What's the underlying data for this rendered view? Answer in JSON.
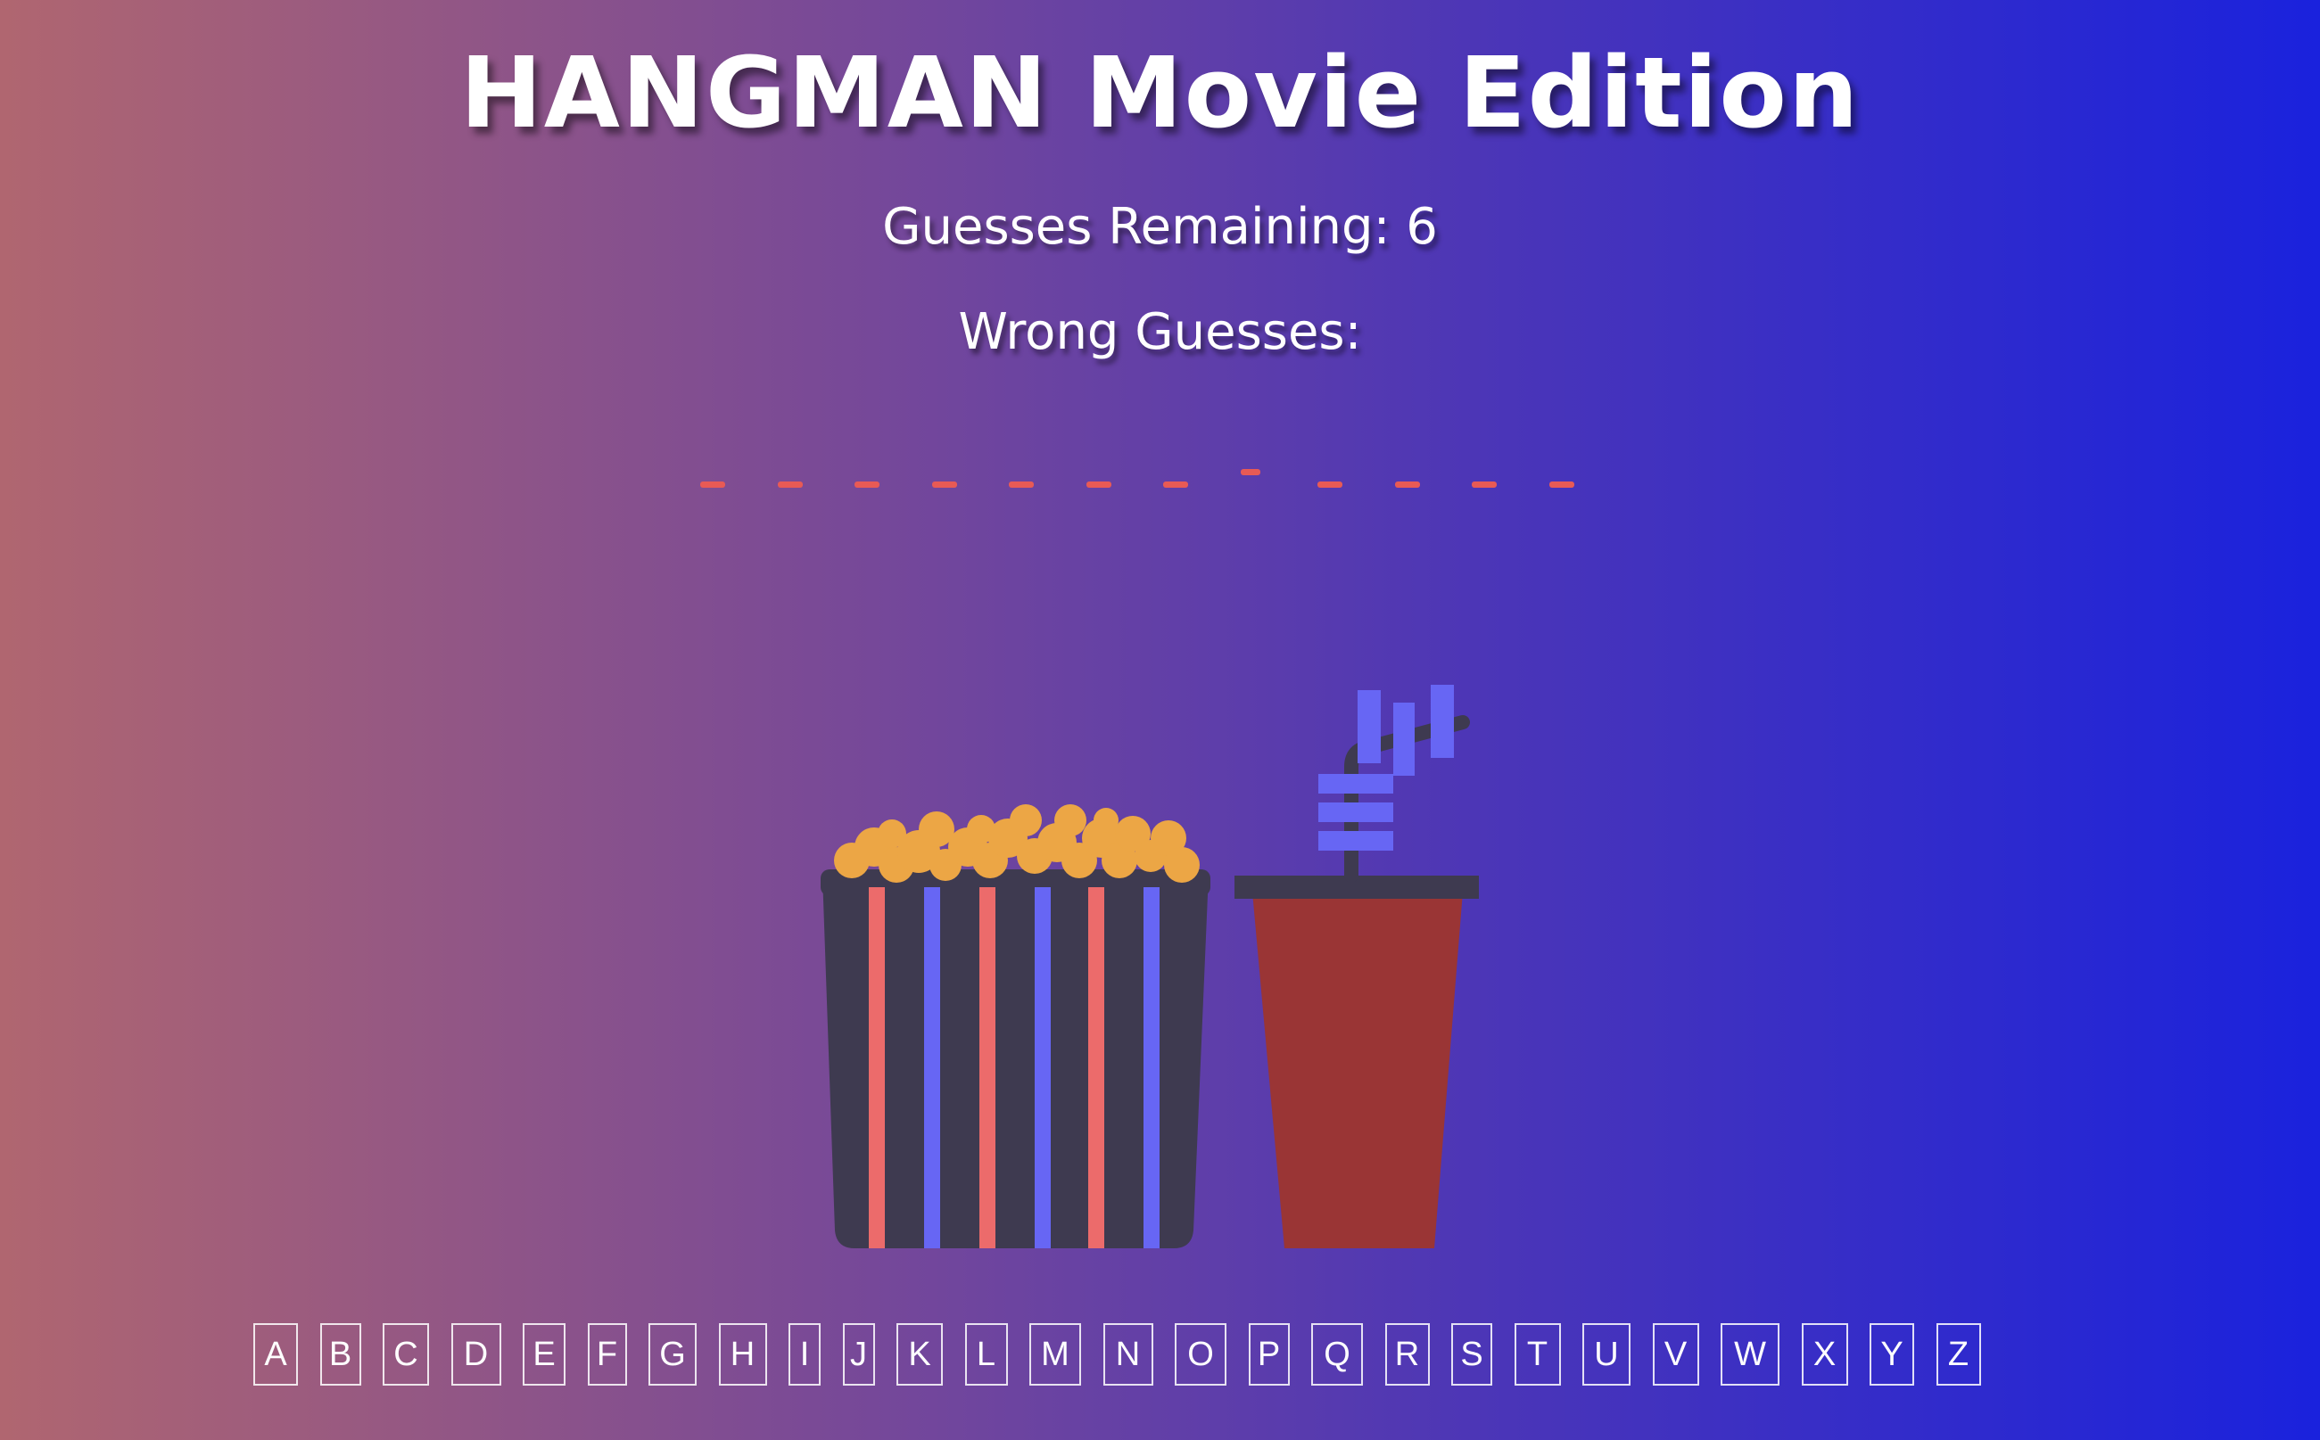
{
  "header": {
    "title": "HANGMAN Movie Edition",
    "guesses_remaining_label": "Guesses Remaining: 6",
    "wrong_guesses_label": "Wrong Guesses:"
  },
  "puzzle": {
    "blank_count": 12,
    "separator_index": 7
  },
  "keyboard": {
    "letters": [
      "A",
      "B",
      "C",
      "D",
      "E",
      "F",
      "G",
      "H",
      "I",
      "J",
      "K",
      "L",
      "M",
      "N",
      "O",
      "P",
      "Q",
      "R",
      "S",
      "T",
      "U",
      "V",
      "W",
      "X",
      "Y",
      "Z"
    ]
  },
  "colors": {
    "blank": "#e85a55",
    "bucket": "#3e3a50",
    "stripe_red": "#ec6b6b",
    "stripe_blue": "#6766f4",
    "popcorn": "#eca645",
    "cup": "#9a3535",
    "lid": "#3e3a50",
    "straw_blue": "#6766f4"
  }
}
